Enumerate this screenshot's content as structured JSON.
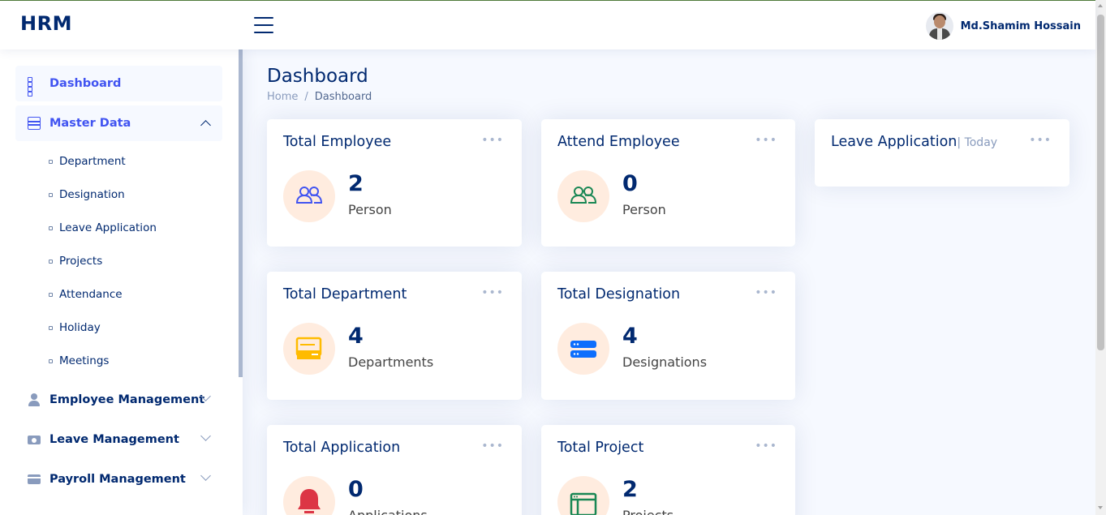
{
  "header": {
    "logo": "HRM",
    "user_name": "Md.Shamim Hossain"
  },
  "sidebar": {
    "items": [
      {
        "label": "Dashboard",
        "icon": "grid-icon",
        "active": true
      },
      {
        "label": "Master Data",
        "icon": "layout-text-window-icon",
        "expanded": true
      },
      {
        "label": "Employee Management",
        "icon": "person-icon",
        "expanded": false
      },
      {
        "label": "Leave Management",
        "icon": "camera-icon",
        "expanded": false
      },
      {
        "label": "Payroll Management",
        "icon": "wallet-icon",
        "expanded": false
      }
    ],
    "master_data_children": [
      {
        "label": "Department"
      },
      {
        "label": "Designation"
      },
      {
        "label": "Leave Application"
      },
      {
        "label": "Projects"
      },
      {
        "label": "Attendance"
      },
      {
        "label": "Holiday"
      },
      {
        "label": "Meetings"
      }
    ]
  },
  "page": {
    "title": "Dashboard",
    "breadcrumb": {
      "home": "Home",
      "separator": "/",
      "current": "Dashboard"
    }
  },
  "cards": [
    {
      "title": "Total Employee",
      "value": "2",
      "unit": "Person",
      "icon": "people-icon",
      "icon_color": "#4154f1"
    },
    {
      "title": "Attend Employee",
      "value": "0",
      "unit": "Person",
      "icon": "people-icon",
      "icon_color": "#2eca6a"
    },
    {
      "title": "Leave Application",
      "subtitle": "| Today"
    },
    {
      "title": "Total Department",
      "value": "4",
      "unit": "Departments",
      "icon": "pc-display-icon",
      "icon_color": "#ffbb00"
    },
    {
      "title": "Total Designation",
      "value": "4",
      "unit": "Designations",
      "icon": "hdd-stack-icon",
      "icon_color": "#0d6efd"
    },
    {
      "title": "Total Application",
      "value": "0",
      "unit": "Applications",
      "icon": "bell-icon",
      "icon_color": "#dc3545"
    },
    {
      "title": "Total Project",
      "value": "2",
      "unit": "Projects",
      "icon": "window-icon",
      "icon_color": "#198754"
    }
  ],
  "card_menu_glyph": "•••"
}
